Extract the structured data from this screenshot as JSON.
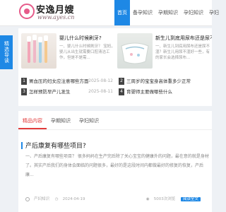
{
  "logo": {
    "title": "安逸月嫂",
    "sub": "www.ayes.cn"
  },
  "nav": [
    {
      "label": "首页",
      "active": true
    },
    {
      "label": "备孕知识",
      "active": false
    },
    {
      "label": "孕期知识",
      "active": false
    },
    {
      "label": "孕妇知识",
      "active": false
    },
    {
      "label": "孕妇",
      "active": false
    }
  ],
  "side_tag": "精选导读",
  "featured": [
    {
      "title": "婴儿什么时候刷牙?",
      "desc": "一、婴儿什么时候刷牙？ 宝妈，婴儿从出生就需要口腔清洁工作，但是不是需..."
    },
    {
      "title": "新生儿到底用尿布还是尿不湿?",
      "desc": "一、新生儿到底用尿布还是尿不湿？新生儿用尿不湿好一些，有的家长会选择尿布..."
    }
  ],
  "list": [
    {
      "num": "1",
      "title": "胃血压的妇女应注意哪些方面",
      "date": "2025-08-12"
    },
    {
      "num": "2",
      "title": "三周岁的宝宝身高体重多少正常",
      "date": "2025-08-12"
    },
    {
      "num": "3",
      "title": "怎样预防早产儿发生",
      "date": "2025-08-11"
    },
    {
      "num": "4",
      "title": "育婴师主要做哪些什么",
      "date": "2025-08-11"
    }
  ],
  "tabs": [
    {
      "label": "精品内容",
      "active": true
    },
    {
      "label": "孕期知识",
      "active": false
    },
    {
      "label": "孕妇知识",
      "active": false
    }
  ],
  "article": {
    "title": "产后康复有哪些项目?",
    "body": "一、产后康复有哪些项目？ 很多妈妈在生产完后除了关心宝宝的健康外的问题，最在意的就是身材了。其实产后我们的身体会面临的问题很多，最好的是这段时间内都做最好的修复的恢复，产后康...",
    "tag": "产妇知识",
    "date": "2024-04-19",
    "views": "5003次浏览",
    "read": "阅读全文"
  }
}
